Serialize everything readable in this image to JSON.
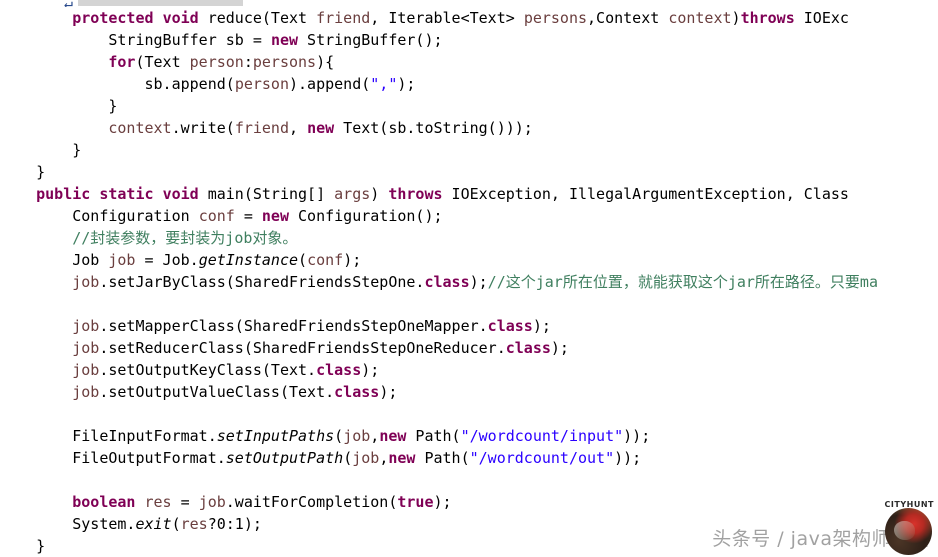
{
  "editor": {
    "language": "Java",
    "theme": "eclipse-light",
    "background": "#ffffff",
    "colors": {
      "keyword": "#7f0055",
      "string": "#2a00ff",
      "comment": "#3f7f5f",
      "parameter": "#6a3e3e",
      "field": "#0000c0",
      "plain": "#000000",
      "selection": "#d4d4d4"
    },
    "top_clipped_line": {
      "visible_fragment": "",
      "has_selection_highlight": true
    }
  },
  "code": {
    "lines": [
      {
        "indent": 2,
        "tokens": [
          {
            "t": "protected",
            "c": "kw"
          },
          {
            "t": " ",
            "c": "pln"
          },
          {
            "t": "void",
            "c": "kw"
          },
          {
            "t": " reduce(Text ",
            "c": "pln"
          },
          {
            "t": "friend",
            "c": "par"
          },
          {
            "t": ", Iterable<Text> ",
            "c": "pln"
          },
          {
            "t": "persons",
            "c": "par"
          },
          {
            "t": ",Context ",
            "c": "pln"
          },
          {
            "t": "context",
            "c": "par"
          },
          {
            "t": ")",
            "c": "pln"
          },
          {
            "t": "throws",
            "c": "kw"
          },
          {
            "t": " IOExc",
            "c": "pln"
          }
        ]
      },
      {
        "indent": 3,
        "tokens": [
          {
            "t": "StringBuffer sb = ",
            "c": "pln"
          },
          {
            "t": "new",
            "c": "kw"
          },
          {
            "t": " StringBuffer();",
            "c": "pln"
          }
        ]
      },
      {
        "indent": 3,
        "tokens": [
          {
            "t": "for",
            "c": "kw"
          },
          {
            "t": "(Text ",
            "c": "pln"
          },
          {
            "t": "person",
            "c": "par"
          },
          {
            "t": ":",
            "c": "pln"
          },
          {
            "t": "persons",
            "c": "par"
          },
          {
            "t": "){",
            "c": "pln"
          }
        ]
      },
      {
        "indent": 4,
        "tokens": [
          {
            "t": "sb.append(",
            "c": "pln"
          },
          {
            "t": "person",
            "c": "par"
          },
          {
            "t": ").append(",
            "c": "pln"
          },
          {
            "t": "\",\"",
            "c": "str"
          },
          {
            "t": ");",
            "c": "pln"
          }
        ]
      },
      {
        "indent": 3,
        "tokens": [
          {
            "t": "}",
            "c": "pln"
          }
        ]
      },
      {
        "indent": 3,
        "tokens": [
          {
            "t": "context",
            "c": "par"
          },
          {
            "t": ".write(",
            "c": "pln"
          },
          {
            "t": "friend",
            "c": "par"
          },
          {
            "t": ", ",
            "c": "pln"
          },
          {
            "t": "new",
            "c": "kw"
          },
          {
            "t": " Text(sb.toString()));",
            "c": "pln"
          }
        ]
      },
      {
        "indent": 2,
        "tokens": [
          {
            "t": "}",
            "c": "pln"
          }
        ]
      },
      {
        "indent": 1,
        "tokens": [
          {
            "t": "}",
            "c": "pln"
          }
        ]
      },
      {
        "indent": 1,
        "tokens": [
          {
            "t": "public",
            "c": "kw"
          },
          {
            "t": " ",
            "c": "pln"
          },
          {
            "t": "static",
            "c": "kw"
          },
          {
            "t": " ",
            "c": "pln"
          },
          {
            "t": "void",
            "c": "kw"
          },
          {
            "t": " main(String[] ",
            "c": "pln"
          },
          {
            "t": "args",
            "c": "par"
          },
          {
            "t": ") ",
            "c": "pln"
          },
          {
            "t": "throws",
            "c": "kw"
          },
          {
            "t": " IOException, IllegalArgumentException, Class",
            "c": "pln"
          }
        ]
      },
      {
        "indent": 2,
        "tokens": [
          {
            "t": "Configuration ",
            "c": "pln"
          },
          {
            "t": "conf",
            "c": "par"
          },
          {
            "t": " = ",
            "c": "pln"
          },
          {
            "t": "new",
            "c": "kw"
          },
          {
            "t": " Configuration();",
            "c": "pln"
          }
        ]
      },
      {
        "indent": 2,
        "tokens": [
          {
            "t": "//封装参数，要封装为job对象。",
            "c": "cmt"
          }
        ]
      },
      {
        "indent": 2,
        "tokens": [
          {
            "t": "Job ",
            "c": "pln"
          },
          {
            "t": "job",
            "c": "par"
          },
          {
            "t": " = Job.",
            "c": "pln"
          },
          {
            "t": "getInstance",
            "c": "stat"
          },
          {
            "t": "(",
            "c": "pln"
          },
          {
            "t": "conf",
            "c": "par"
          },
          {
            "t": ");",
            "c": "pln"
          }
        ]
      },
      {
        "indent": 2,
        "tokens": [
          {
            "t": "job",
            "c": "par"
          },
          {
            "t": ".setJarByClass(SharedFriendsStepOne.",
            "c": "pln"
          },
          {
            "t": "class",
            "c": "kw"
          },
          {
            "t": ");",
            "c": "pln"
          },
          {
            "t": "//这个jar所在位置，就能获取这个jar所在路径。只要ma",
            "c": "cmt"
          }
        ]
      },
      {
        "indent": 0,
        "tokens": []
      },
      {
        "indent": 2,
        "tokens": [
          {
            "t": "job",
            "c": "par"
          },
          {
            "t": ".setMapperClass(SharedFriendsStepOneMapper.",
            "c": "pln"
          },
          {
            "t": "class",
            "c": "kw"
          },
          {
            "t": ");",
            "c": "pln"
          }
        ]
      },
      {
        "indent": 2,
        "tokens": [
          {
            "t": "job",
            "c": "par"
          },
          {
            "t": ".setReducerClass(SharedFriendsStepOneReducer.",
            "c": "pln"
          },
          {
            "t": "class",
            "c": "kw"
          },
          {
            "t": ");",
            "c": "pln"
          }
        ]
      },
      {
        "indent": 2,
        "tokens": [
          {
            "t": "job",
            "c": "par"
          },
          {
            "t": ".setOutputKeyClass(Text.",
            "c": "pln"
          },
          {
            "t": "class",
            "c": "kw"
          },
          {
            "t": ");",
            "c": "pln"
          }
        ]
      },
      {
        "indent": 2,
        "tokens": [
          {
            "t": "job",
            "c": "par"
          },
          {
            "t": ".setOutputValueClass(Text.",
            "c": "pln"
          },
          {
            "t": "class",
            "c": "kw"
          },
          {
            "t": ");",
            "c": "pln"
          }
        ]
      },
      {
        "indent": 0,
        "tokens": []
      },
      {
        "indent": 2,
        "tokens": [
          {
            "t": "FileInputFormat.",
            "c": "pln"
          },
          {
            "t": "setInputPaths",
            "c": "stat"
          },
          {
            "t": "(",
            "c": "pln"
          },
          {
            "t": "job",
            "c": "par"
          },
          {
            "t": ",",
            "c": "pln"
          },
          {
            "t": "new",
            "c": "kw"
          },
          {
            "t": " Path(",
            "c": "pln"
          },
          {
            "t": "\"/wordcount/input\"",
            "c": "str"
          },
          {
            "t": "));",
            "c": "pln"
          }
        ]
      },
      {
        "indent": 2,
        "tokens": [
          {
            "t": "FileOutputFormat.",
            "c": "pln"
          },
          {
            "t": "setOutputPath",
            "c": "stat"
          },
          {
            "t": "(",
            "c": "pln"
          },
          {
            "t": "job",
            "c": "par"
          },
          {
            "t": ",",
            "c": "pln"
          },
          {
            "t": "new",
            "c": "kw"
          },
          {
            "t": " Path(",
            "c": "pln"
          },
          {
            "t": "\"/wordcount/out\"",
            "c": "str"
          },
          {
            "t": "));",
            "c": "pln"
          }
        ]
      },
      {
        "indent": 0,
        "tokens": []
      },
      {
        "indent": 2,
        "tokens": [
          {
            "t": "boolean",
            "c": "kw"
          },
          {
            "t": " ",
            "c": "pln"
          },
          {
            "t": "res",
            "c": "par"
          },
          {
            "t": " = ",
            "c": "pln"
          },
          {
            "t": "job",
            "c": "par"
          },
          {
            "t": ".waitForCompletion(",
            "c": "pln"
          },
          {
            "t": "true",
            "c": "kw"
          },
          {
            "t": ");",
            "c": "pln"
          }
        ]
      },
      {
        "indent": 2,
        "tokens": [
          {
            "t": "System.",
            "c": "pln"
          },
          {
            "t": "exit",
            "c": "stat"
          },
          {
            "t": "(",
            "c": "pln"
          },
          {
            "t": "res",
            "c": "par"
          },
          {
            "t": "?0:1);",
            "c": "pln"
          }
        ]
      },
      {
        "indent": 1,
        "tokens": [
          {
            "t": "}",
            "c": "pln"
          }
        ]
      }
    ]
  },
  "watermark": {
    "text": "头条号 / java架构师之路",
    "badge": "CITYHUNT",
    "avatar_alt": "profile-avatar"
  }
}
